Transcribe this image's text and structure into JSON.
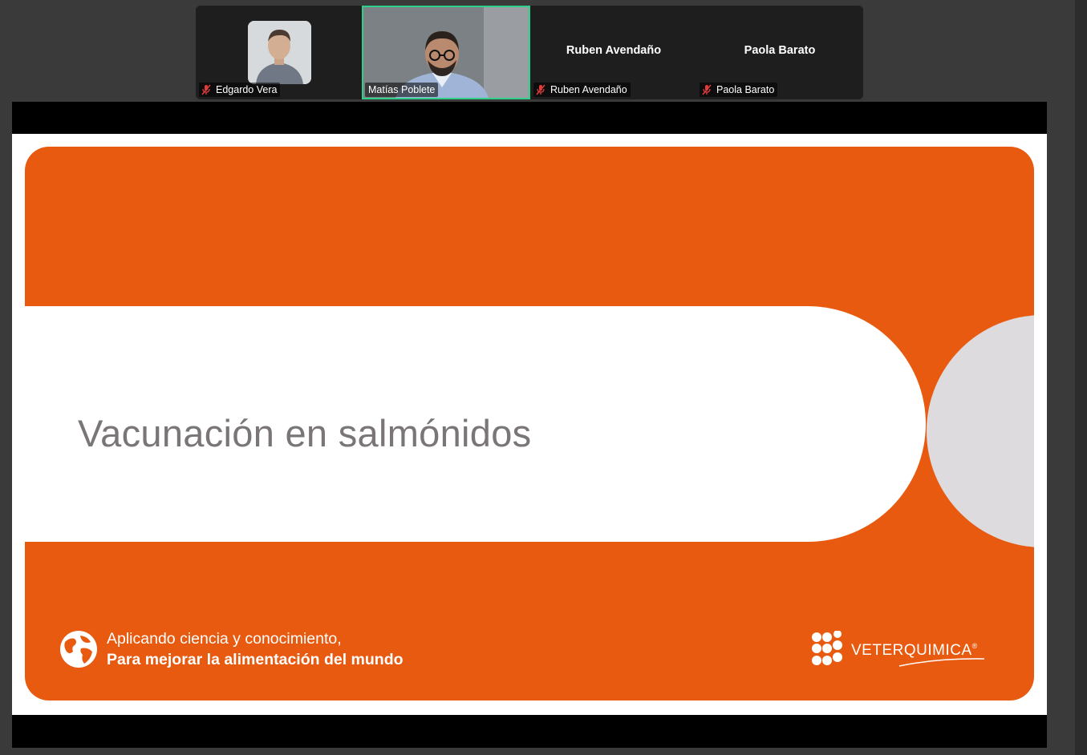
{
  "participants": [
    {
      "name": "Edgardo Vera",
      "muted": true,
      "display": "photo"
    },
    {
      "name": "Matías Poblete",
      "muted": false,
      "display": "video",
      "active_speaker": true
    },
    {
      "name": "Ruben Avendaño",
      "muted": true,
      "display": "name"
    },
    {
      "name": "Paola Barato",
      "muted": true,
      "display": "name"
    }
  ],
  "slide": {
    "title": "Vacunación en salmónidos",
    "tagline_line1": "Aplicando ciencia y conocimiento,",
    "tagline_line2": "Para mejorar la alimentación del mundo",
    "brand_name": "VETERQUIMICA",
    "registered_mark": "®"
  },
  "colors": {
    "accent_orange": "#e85a0f",
    "title_grey": "#7a7576",
    "circle_grey": "#dddbde",
    "active_speaker_border": "#2fd18a",
    "strip_background": "#1e1e1e"
  },
  "icons": {
    "muted": "mic-muted-icon",
    "globe": "globe-icon",
    "brand": "brand-logo-mark"
  }
}
